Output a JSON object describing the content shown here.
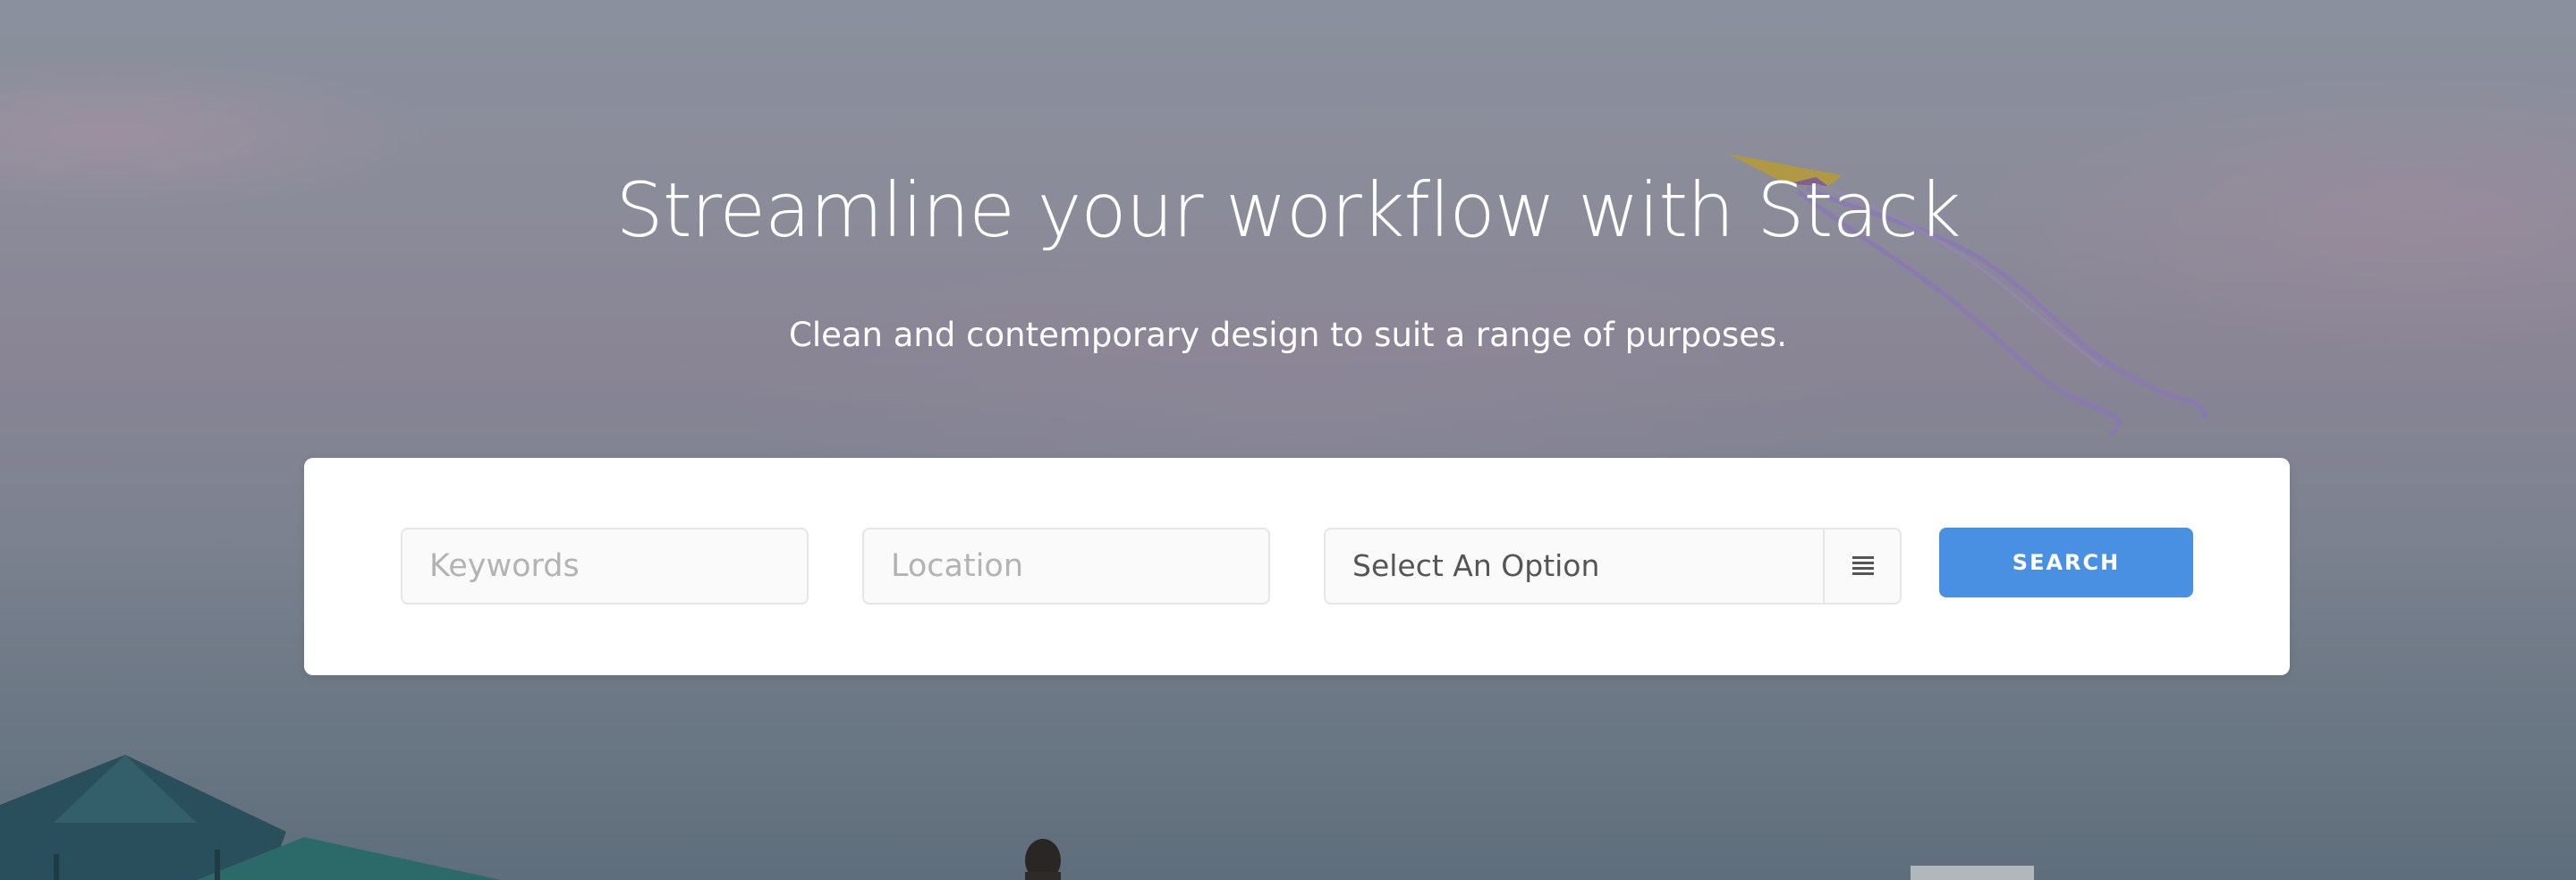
{
  "hero": {
    "headline": "Streamline your workflow with Stack",
    "subheadline": "Clean and contemporary design to suit a range of purposes."
  },
  "search": {
    "keywords_placeholder": "Keywords",
    "keywords_value": "",
    "location_placeholder": "Location",
    "location_value": "",
    "category_selected": "Select An Option",
    "search_label": "SEARCH"
  },
  "icons": {
    "select": "list-icon"
  },
  "colors": {
    "accent": "#4a90e2",
    "card": "#ffffff",
    "field_border": "#e6e6e6",
    "field_bg": "#fafafa",
    "text": "#555555",
    "placeholder": "#b3b3b3"
  }
}
